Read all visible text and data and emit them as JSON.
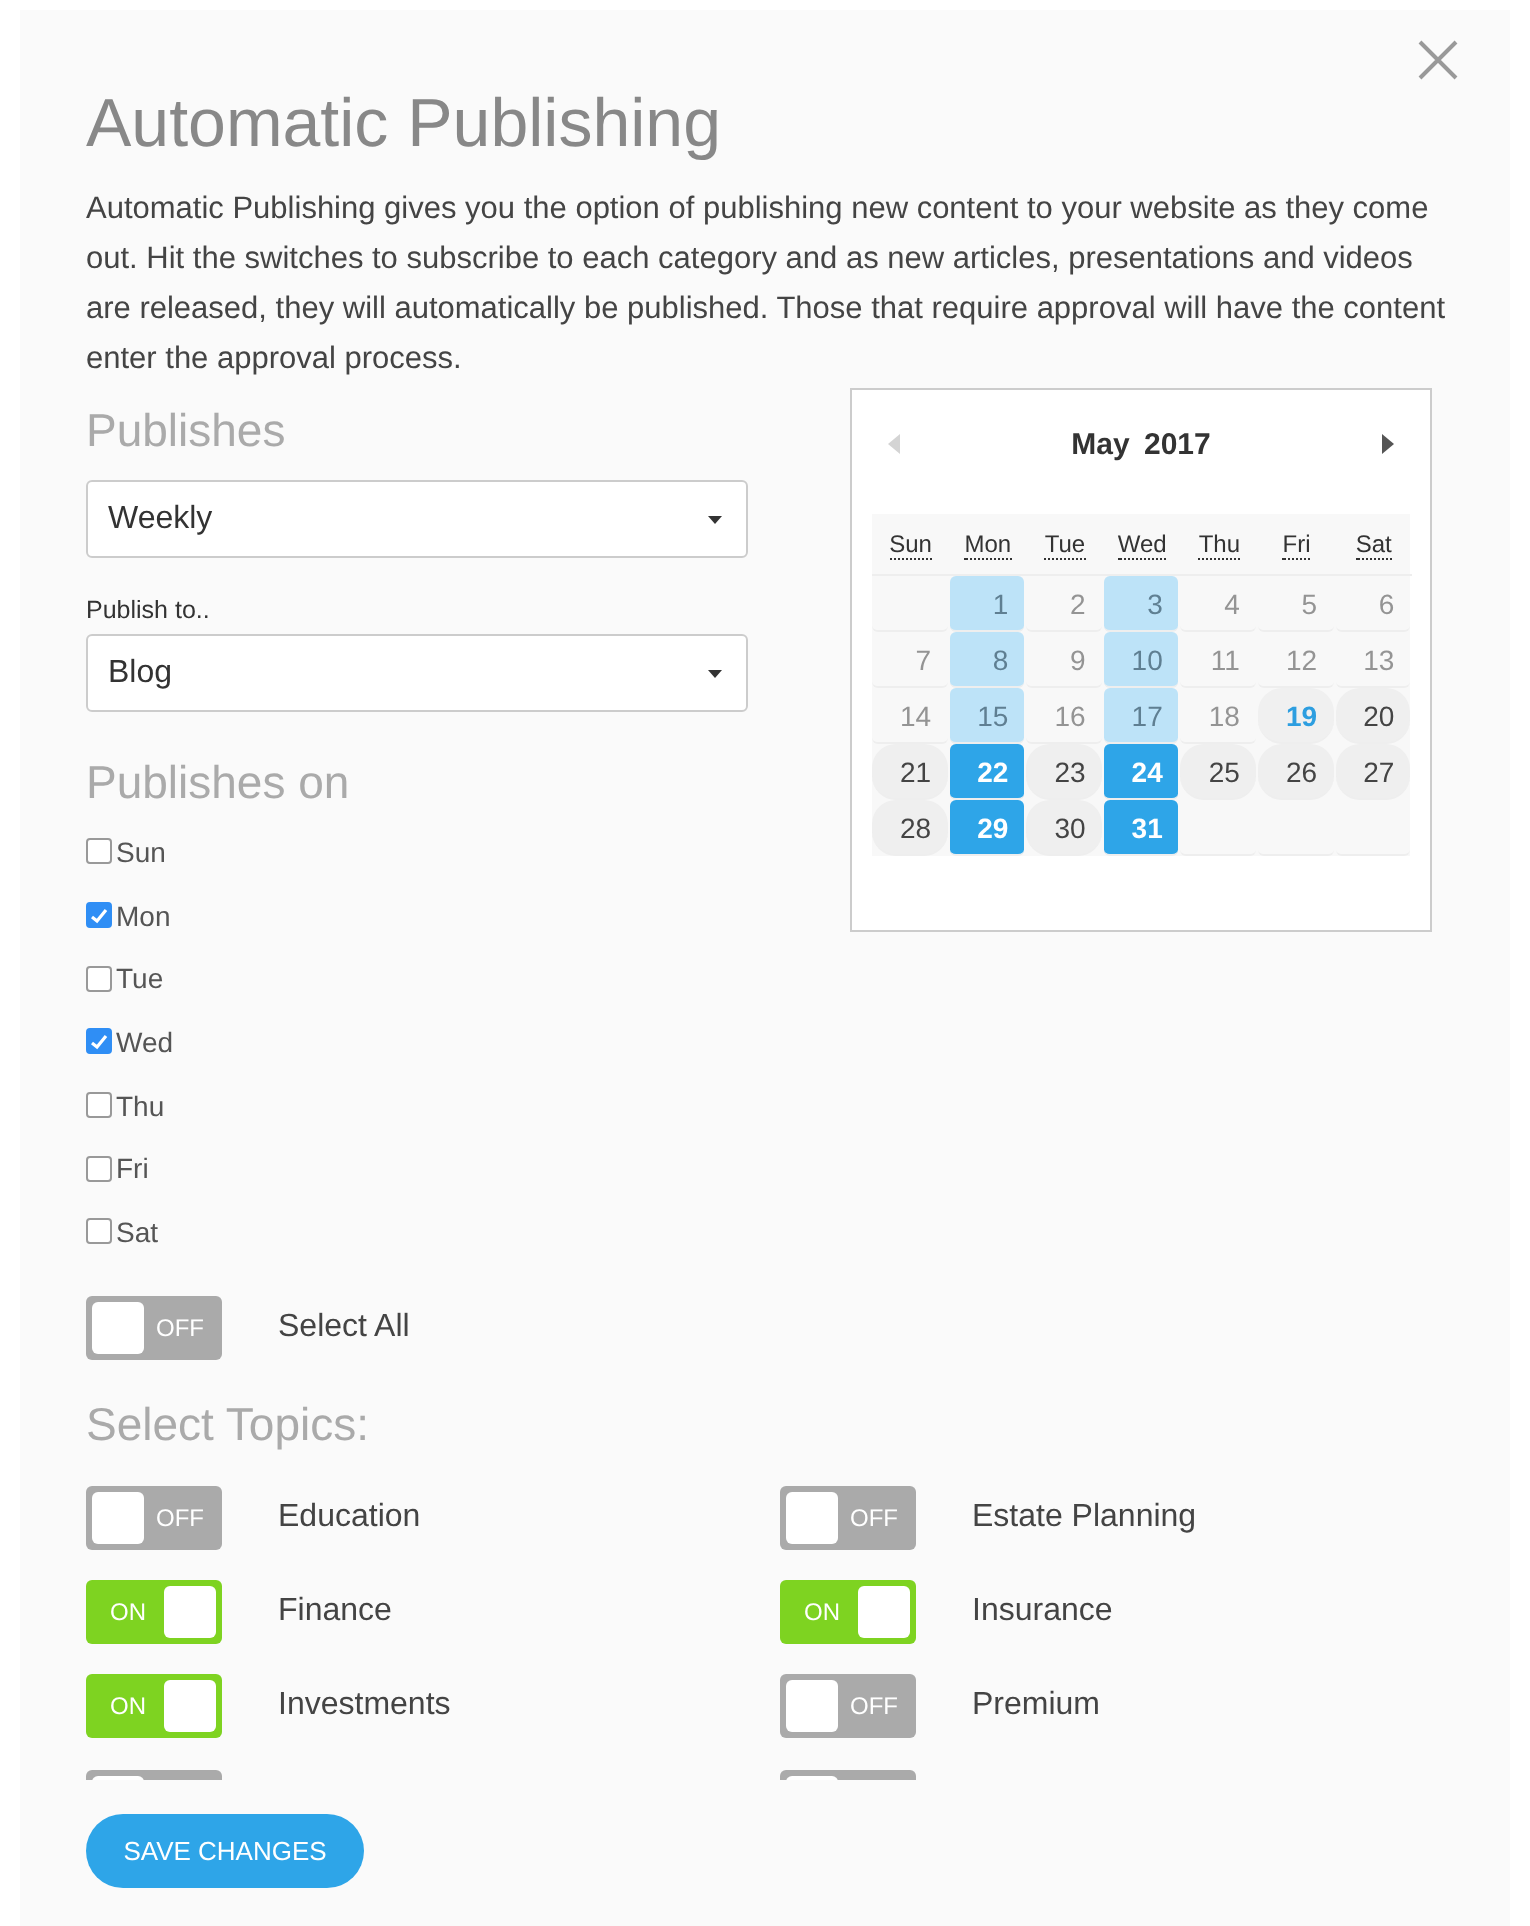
{
  "title": "Automatic Publishing",
  "description": "Automatic Publishing gives you the option of publishing new content to your website as they come out. Hit the switches to subscribe to each category and as new articles, presentations and videos are released, they will automatically be published. Those that require approval will have the content enter the approval process.",
  "publishes": {
    "label": "Publishes",
    "value": "Weekly"
  },
  "publish_to": {
    "label": "Publish to..",
    "value": "Blog"
  },
  "publishes_on": {
    "label": "Publishes on",
    "days": [
      {
        "label": "Sun",
        "checked": false
      },
      {
        "label": "Mon",
        "checked": true
      },
      {
        "label": "Tue",
        "checked": false
      },
      {
        "label": "Wed",
        "checked": true
      },
      {
        "label": "Thu",
        "checked": false
      },
      {
        "label": "Fri",
        "checked": false
      },
      {
        "label": "Sat",
        "checked": false
      }
    ]
  },
  "calendar": {
    "month": "May 2017",
    "prev_disabled": true,
    "next_disabled": false,
    "weekdays": [
      "Sun",
      "Mon",
      "Tue",
      "Wed",
      "Thu",
      "Fri",
      "Sat"
    ],
    "weeks": [
      [
        {
          "kind": "blank"
        },
        {
          "day": "1",
          "kind": "past-marked"
        },
        {
          "day": "2",
          "kind": "past"
        },
        {
          "day": "3",
          "kind": "past-marked"
        },
        {
          "day": "4",
          "kind": "past"
        },
        {
          "day": "5",
          "kind": "past"
        },
        {
          "day": "6",
          "kind": "past"
        }
      ],
      [
        {
          "day": "7",
          "kind": "past"
        },
        {
          "day": "8",
          "kind": "past-marked"
        },
        {
          "day": "9",
          "kind": "past"
        },
        {
          "day": "10",
          "kind": "past-marked"
        },
        {
          "day": "11",
          "kind": "past"
        },
        {
          "day": "12",
          "kind": "past"
        },
        {
          "day": "13",
          "kind": "past"
        }
      ],
      [
        {
          "day": "14",
          "kind": "past"
        },
        {
          "day": "15",
          "kind": "past-marked"
        },
        {
          "day": "16",
          "kind": "past"
        },
        {
          "day": "17",
          "kind": "past-marked"
        },
        {
          "day": "18",
          "kind": "past"
        },
        {
          "day": "19",
          "kind": "today"
        },
        {
          "day": "20",
          "kind": "future"
        }
      ],
      [
        {
          "day": "21",
          "kind": "future"
        },
        {
          "day": "22",
          "kind": "marked"
        },
        {
          "day": "23",
          "kind": "future"
        },
        {
          "day": "24",
          "kind": "marked"
        },
        {
          "day": "25",
          "kind": "future"
        },
        {
          "day": "26",
          "kind": "future"
        },
        {
          "day": "27",
          "kind": "future"
        }
      ],
      [
        {
          "day": "28",
          "kind": "future"
        },
        {
          "day": "29",
          "kind": "marked"
        },
        {
          "day": "30",
          "kind": "future"
        },
        {
          "day": "31",
          "kind": "marked"
        },
        {
          "kind": "blank"
        },
        {
          "kind": "blank"
        },
        {
          "kind": "blank"
        }
      ]
    ]
  },
  "select_all": {
    "label": "Select All",
    "on": false,
    "switch_text": "OFF"
  },
  "topics_heading": "Select Topics:",
  "topics": [
    {
      "label": "Education",
      "on": false,
      "switch_text": "OFF"
    },
    {
      "label": "Estate Planning",
      "on": false,
      "switch_text": "OFF"
    },
    {
      "label": "Finance",
      "on": true,
      "switch_text": "ON"
    },
    {
      "label": "Insurance",
      "on": true,
      "switch_text": "ON"
    },
    {
      "label": "Investments",
      "on": true,
      "switch_text": "ON"
    },
    {
      "label": "Premium",
      "on": false,
      "switch_text": "OFF"
    },
    {
      "on": false
    },
    {
      "on": false
    }
  ],
  "save_button": "SAVE CHANGES"
}
